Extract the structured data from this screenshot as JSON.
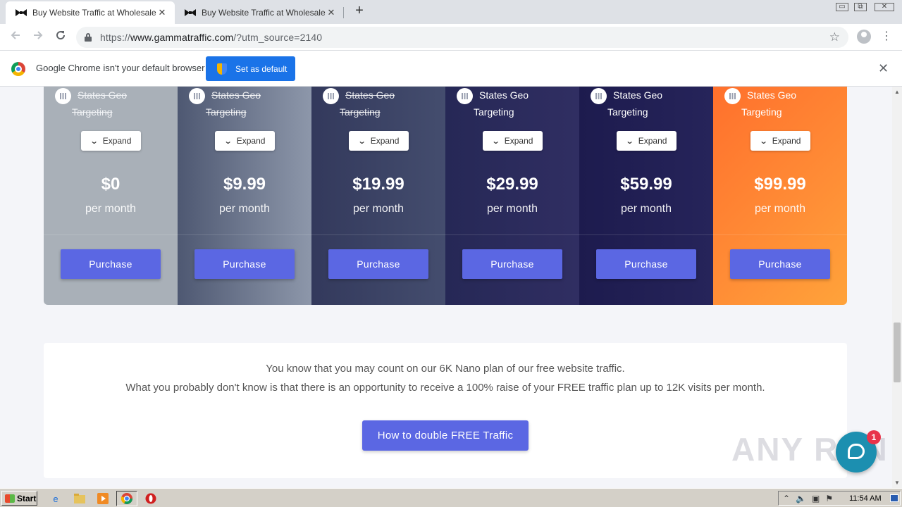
{
  "browser": {
    "tabs": [
      {
        "title": "Buy Website Traffic at Wholesale Ra",
        "close": "✕",
        "active": true
      },
      {
        "title": "Buy Website Traffic at Wholesale Ra",
        "close": "✕",
        "active": false
      }
    ],
    "new_tab": "+",
    "window_controls": {
      "minimize": "▭",
      "restore": "⧉",
      "close": "✕"
    },
    "url_scheme": "https://",
    "url_host": "www.gammatraffic.com",
    "url_path": "/?utm_source=2140",
    "infobar": {
      "message": "Google Chrome isn't your default browser",
      "button": "Set as default",
      "close": "✕"
    }
  },
  "plans": [
    {
      "feature_line1": "States Geo",
      "feature_line2": "Targeting",
      "feature_included": false,
      "expand": "Expand",
      "price": "$0",
      "period": "per month",
      "purchase": "Purchase"
    },
    {
      "feature_line1": "States Geo",
      "feature_line2": "Targeting",
      "feature_included": false,
      "expand": "Expand",
      "price": "$9.99",
      "period": "per month",
      "purchase": "Purchase"
    },
    {
      "feature_line1": "States Geo",
      "feature_line2": "Targeting",
      "feature_included": false,
      "expand": "Expand",
      "price": "$19.99",
      "period": "per month",
      "purchase": "Purchase"
    },
    {
      "feature_line1": "States Geo",
      "feature_line2": "Targeting",
      "feature_included": true,
      "expand": "Expand",
      "price": "$29.99",
      "period": "per month",
      "purchase": "Purchase"
    },
    {
      "feature_line1": "States Geo",
      "feature_line2": "Targeting",
      "feature_included": true,
      "expand": "Expand",
      "price": "$59.99",
      "period": "per month",
      "purchase": "Purchase"
    },
    {
      "feature_line1": "States Geo",
      "feature_line2": "Targeting",
      "feature_included": true,
      "expand": "Expand",
      "price": "$99.99",
      "period": "per month",
      "purchase": "Purchase"
    }
  ],
  "info": {
    "line1": "You know that you may count on our 6K Nano plan of our free website traffic.",
    "line2": "What you probably don't know is that there is an opportunity to receive a 100% raise of your FREE traffic plan up to 12K visits per month.",
    "button": "How to double FREE Traffic"
  },
  "watermark": "ANY RUN",
  "chat": {
    "badge": "1"
  },
  "taskbar": {
    "start": "Start",
    "clock": "11:54 AM"
  },
  "colors": {
    "accent_button": "#5b67e3",
    "chrome_blue": "#1a73e8",
    "premium_orange": "#ff8d36"
  }
}
